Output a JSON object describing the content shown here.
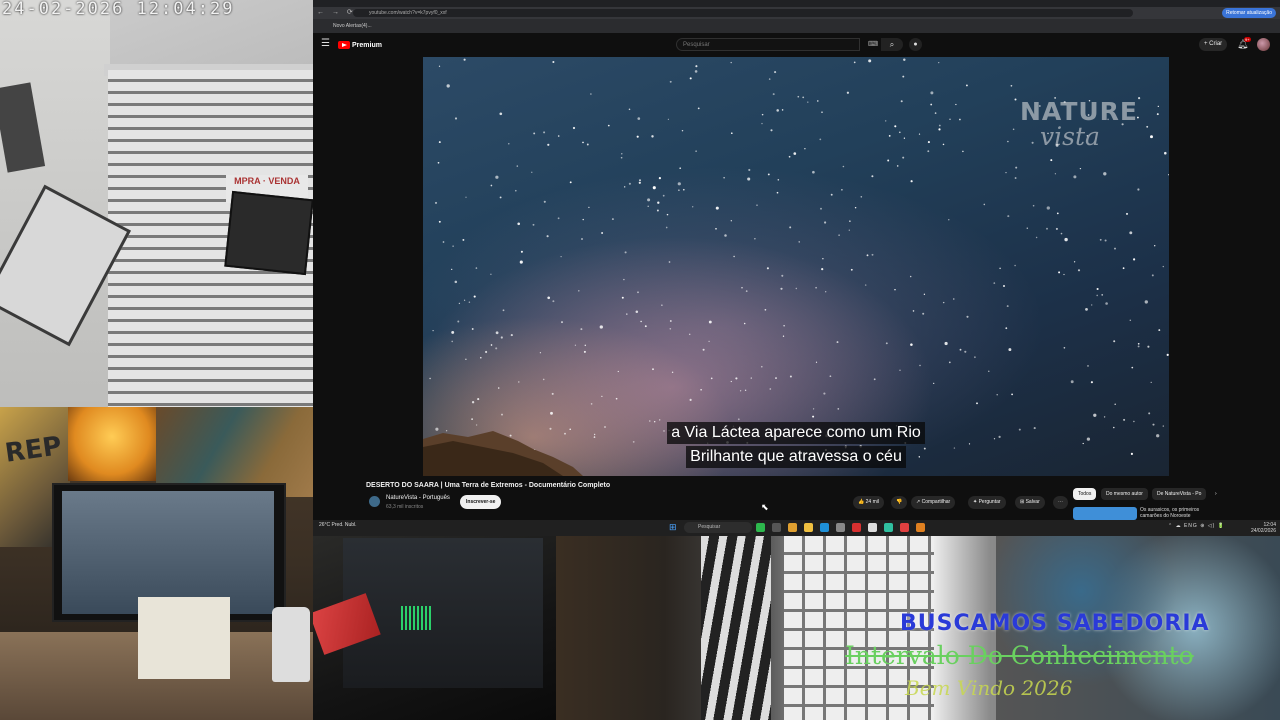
{
  "cctv": {
    "timestamp": "24-02-2026  12:04:29",
    "sign_text": "MPRA · VENDA"
  },
  "browser": {
    "url": "youtube.com/watch?v=k7pvyf0_xxf",
    "profile_button": "Retomar atualização",
    "bookmark": "Novo Alertas(4)...",
    "nav_icons": "← → ⟳"
  },
  "youtube": {
    "logo_text": "Premium",
    "search_placeholder": "Pesquisar",
    "create_label": "+ Criar",
    "notifications": "9+",
    "video": {
      "watermark_top": "NATURE",
      "watermark_bottom": "vista",
      "subtitle_line1": "a Via Láctea aparece como um Rio",
      "subtitle_line2": "Brilhante que atravessa o céu",
      "title": "DESERTO DO SAARA | Uma Terra de Extremos - Documentário Completo",
      "channel": "NatureVista - Português",
      "subscribers": "63,3 mil inscritos",
      "subscribe_label": "Inscrever-se"
    },
    "actions": {
      "like": "👍 24 mil",
      "dislike": "👎",
      "share": "↗ Compartilhar",
      "ask": "✦ Perguntar",
      "save": "⊞ Salvar",
      "more": "⋯"
    },
    "chips": [
      "Todos",
      "Do mesmo autor",
      "De NatureVista - Po",
      "›"
    ],
    "recommendation_title": "Os aurasicos, os primeiros camarões do Noroeste"
  },
  "taskbar": {
    "weather": "26°C Pred. Nubl.",
    "search_placeholder": "Pesquisar",
    "tray": "⌃ ☁ ENG ⊕ ◁) 🔋",
    "time": "12:04",
    "date": "24/02/2026"
  },
  "cam2": {
    "art_text": "REP"
  },
  "overlay": {
    "line1": "BUSCAMOS SABEDORIA",
    "line2": "Intervalo Do Conhecimento",
    "line3": "Bem Vindo 2026"
  },
  "colors": {
    "youtube_red": "#ff0000",
    "overlay_blue": "#2a3ad8",
    "overlay_green": "#6ad060",
    "overlay_yellow": "#c8d850"
  }
}
